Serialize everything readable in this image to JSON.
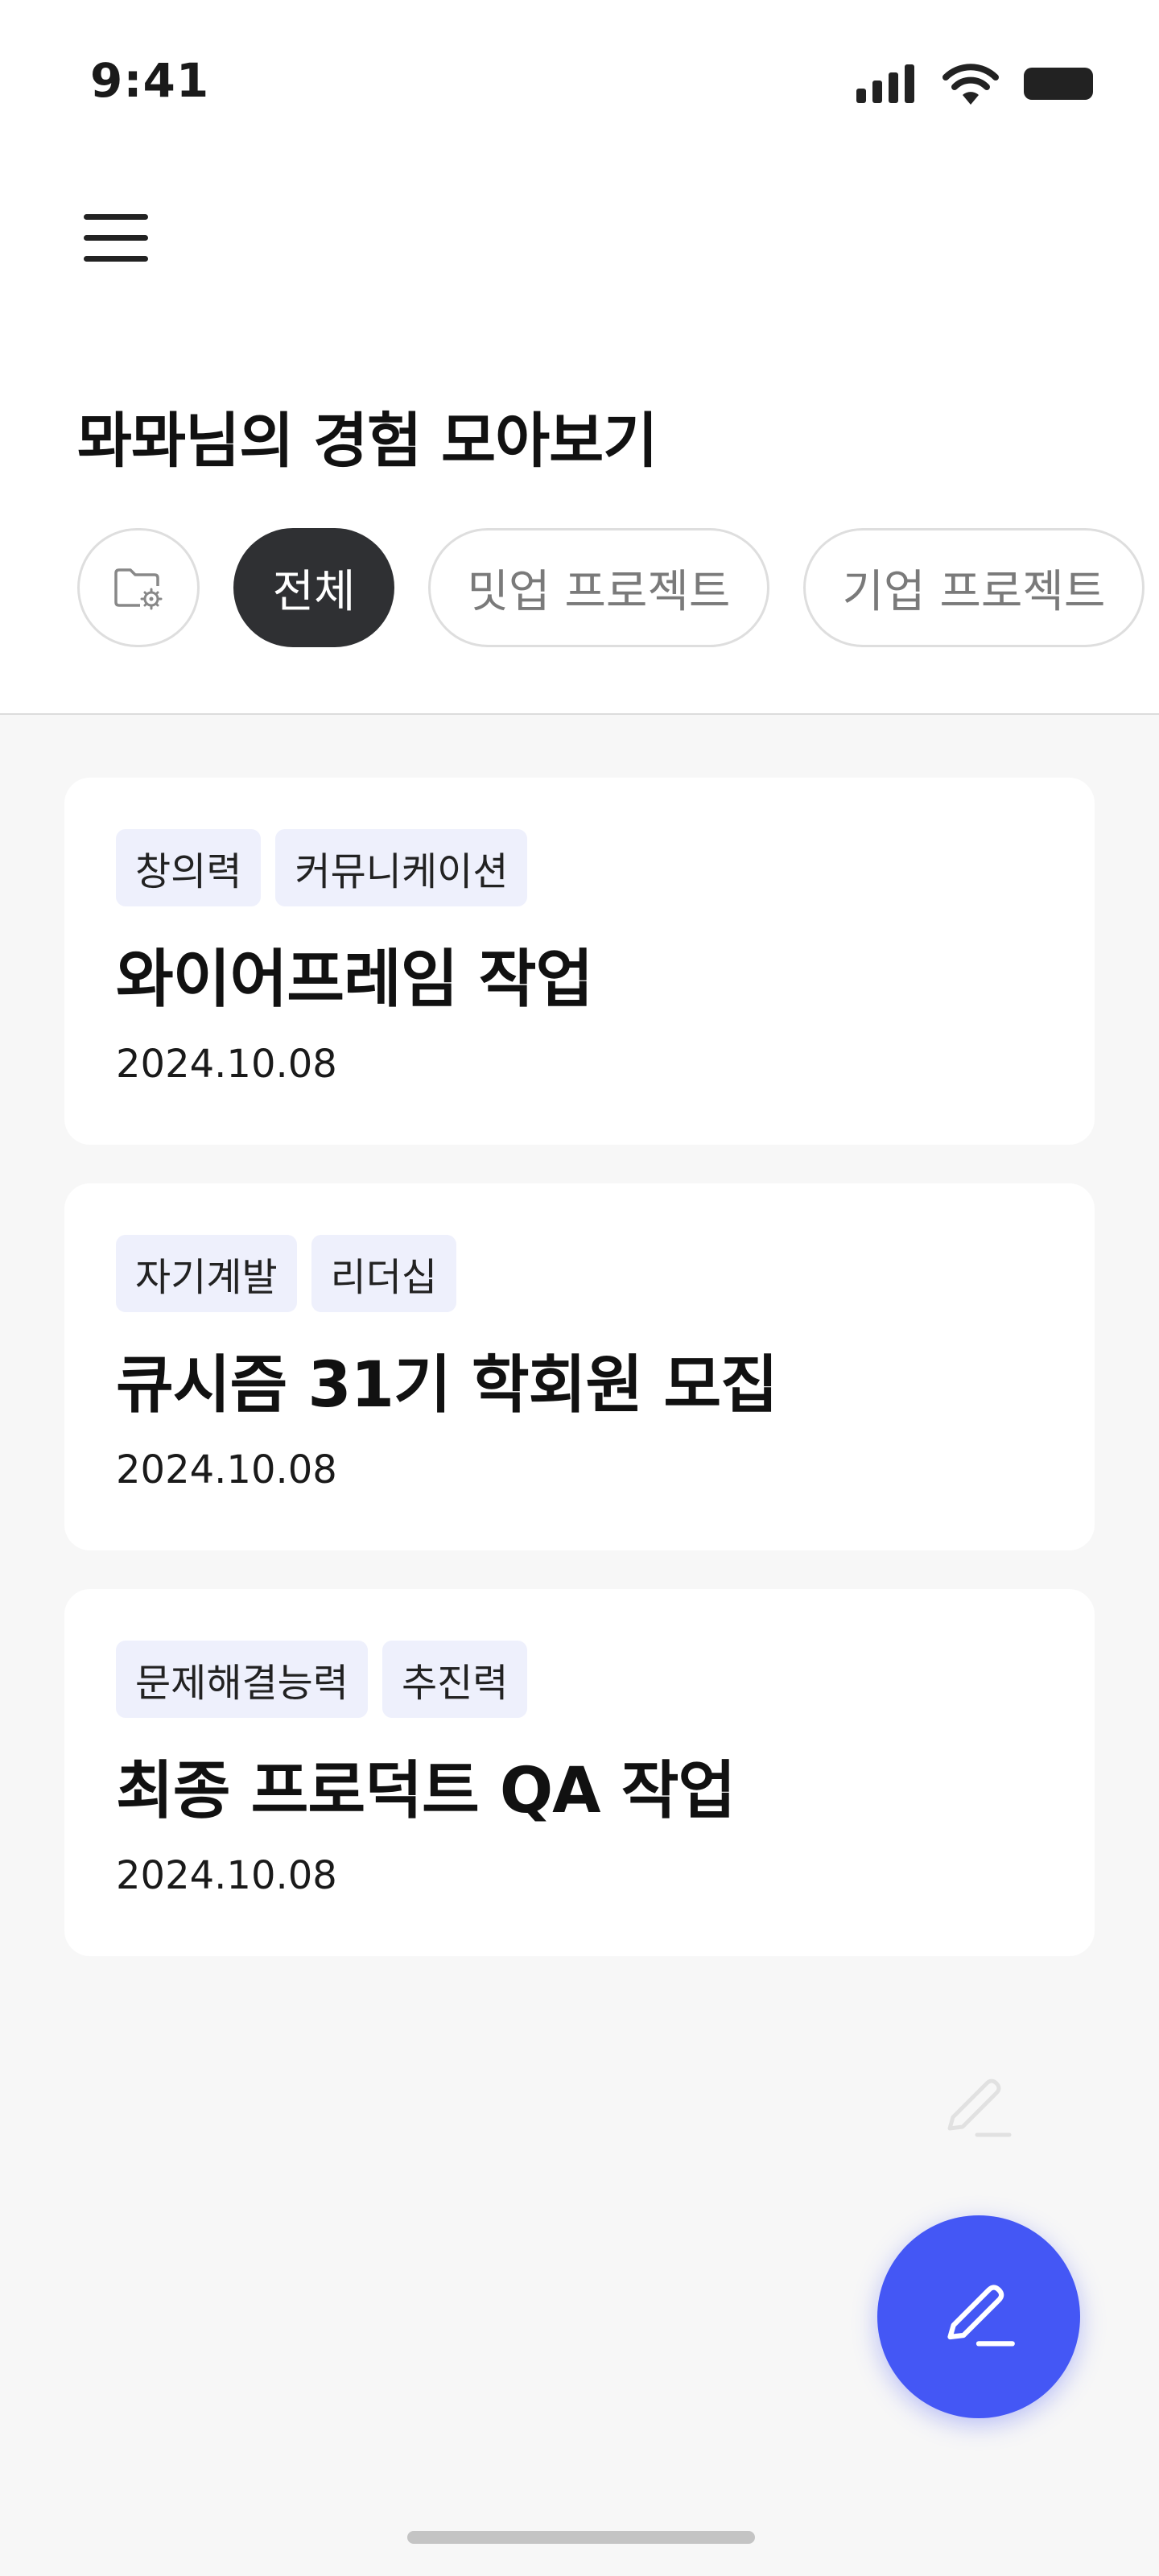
{
  "status_bar": {
    "time": "9:41",
    "icons": [
      "cellular-signal-icon",
      "wifi-icon",
      "battery-icon"
    ]
  },
  "header": {
    "menu_icon": "hamburger-menu-icon",
    "title": "뫄뫄님의 경험 모아보기"
  },
  "filters": {
    "folder_icon": "folder-settings-icon",
    "items": [
      {
        "label": "전체",
        "active": true
      },
      {
        "label": "밋업 프로젝트",
        "active": false
      },
      {
        "label": "기업 프로젝트",
        "active": false
      }
    ]
  },
  "experiences": [
    {
      "tags": [
        "창의력",
        "커뮤니케이션"
      ],
      "title": "와이어프레임 작업",
      "date": "2024.10.08"
    },
    {
      "tags": [
        "자기계발",
        "리더십"
      ],
      "title": "큐시즘 31기 학회원 모집",
      "date": "2024.10.08"
    },
    {
      "tags": [
        "문제해결능력",
        "추진력"
      ],
      "title": "최종 프로덕트 QA 작업",
      "date": "2024.10.08"
    }
  ],
  "fab": {
    "icon": "pencil-icon"
  },
  "colors": {
    "accent": "#4457f5",
    "tag_bg": "#eef0fc",
    "active_chip": "#2f3033",
    "background": "#f7f7f7"
  }
}
